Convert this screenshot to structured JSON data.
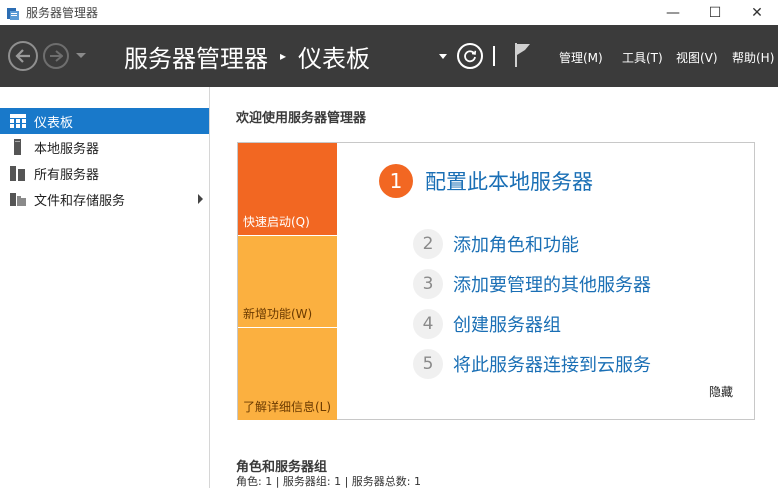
{
  "window": {
    "title": "服务器管理器",
    "minimize_glyph": "—",
    "maximize_glyph": "☐",
    "close_glyph": "✕"
  },
  "header": {
    "breadcrumb_root": "服务器管理器",
    "breadcrumb_sep": "▸",
    "breadcrumb_current": "仪表板",
    "menus": {
      "manage": "管理(M)",
      "tools": "工具(T)",
      "view": "视图(V)",
      "help": "帮助(H)"
    }
  },
  "sidebar": {
    "items": [
      {
        "label": "仪表板",
        "icon": "dashboard-grid-icon",
        "active": true
      },
      {
        "label": "本地服务器",
        "icon": "server-icon"
      },
      {
        "label": "所有服务器",
        "icon": "servers-icon"
      },
      {
        "label": "文件和存储服务",
        "icon": "file-storage-icon",
        "has_arrow": true
      }
    ]
  },
  "main": {
    "welcome_title": "欢迎使用服务器管理器",
    "tiles": {
      "quick_start": "快速启动(Q)",
      "whats_new": "新增功能(W)",
      "learn_more": "了解详细信息(L)"
    },
    "steps": [
      {
        "num": "1",
        "label": "配置此本地服务器"
      },
      {
        "num": "2",
        "label": "添加角色和功能"
      },
      {
        "num": "3",
        "label": "添加要管理的其他服务器"
      },
      {
        "num": "4",
        "label": "创建服务器组"
      },
      {
        "num": "5",
        "label": "将此服务器连接到云服务"
      }
    ],
    "hide_label": "隐藏",
    "roles_title": "角色和服务器组",
    "roles_summary": "角色: 1 | 服务器组: 1 | 服务器总数: 1"
  },
  "colors": {
    "header_bg": "#3b3b3b",
    "accent_blue": "#1979ca",
    "link_blue": "#1a6fb5",
    "tile_orange": "#f26722",
    "tile_amber": "#fbb040"
  }
}
